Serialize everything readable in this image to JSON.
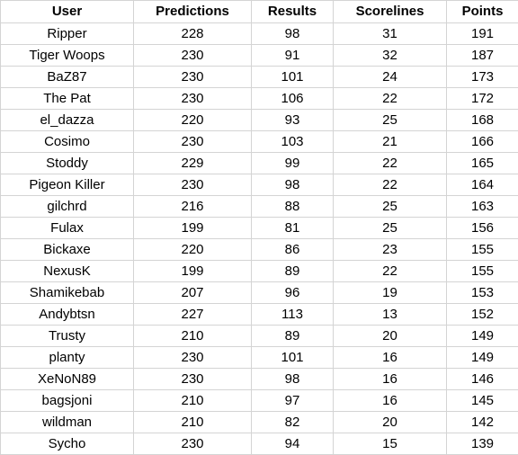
{
  "table": {
    "headers": [
      "User",
      "Predictions",
      "Results",
      "Scorelines",
      "Points"
    ],
    "rows": [
      [
        "Ripper",
        "228",
        "98",
        "31",
        "191"
      ],
      [
        "Tiger Woops",
        "230",
        "91",
        "32",
        "187"
      ],
      [
        "BaZ87",
        "230",
        "101",
        "24",
        "173"
      ],
      [
        "The Pat",
        "230",
        "106",
        "22",
        "172"
      ],
      [
        "el_dazza",
        "220",
        "93",
        "25",
        "168"
      ],
      [
        "Cosimo",
        "230",
        "103",
        "21",
        "166"
      ],
      [
        "Stoddy",
        "229",
        "99",
        "22",
        "165"
      ],
      [
        "Pigeon Killer",
        "230",
        "98",
        "22",
        "164"
      ],
      [
        "gilchrd",
        "216",
        "88",
        "25",
        "163"
      ],
      [
        "Fulax",
        "199",
        "81",
        "25",
        "156"
      ],
      [
        "Bickaxe",
        "220",
        "86",
        "23",
        "155"
      ],
      [
        "NexusK",
        "199",
        "89",
        "22",
        "155"
      ],
      [
        "Shamikebab",
        "207",
        "96",
        "19",
        "153"
      ],
      [
        "Andybtsn",
        "227",
        "113",
        "13",
        "152"
      ],
      [
        "Trusty",
        "210",
        "89",
        "20",
        "149"
      ],
      [
        "planty",
        "230",
        "101",
        "16",
        "149"
      ],
      [
        "XeNoN89",
        "230",
        "98",
        "16",
        "146"
      ],
      [
        "bagsjoni",
        "210",
        "97",
        "16",
        "145"
      ],
      [
        "wildman",
        "210",
        "82",
        "20",
        "142"
      ],
      [
        "Sycho",
        "230",
        "94",
        "15",
        "139"
      ]
    ]
  }
}
